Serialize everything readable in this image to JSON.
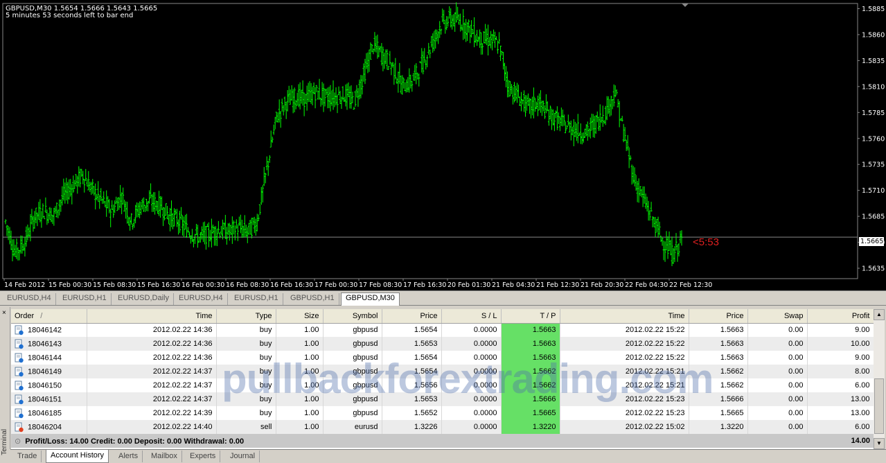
{
  "chart": {
    "title": "GBPUSD,M30  1.5654 1.5666 1.5643 1.5665",
    "subtitle": "5 minutes 53 seconds left to bar end",
    "countdown": "<5:53",
    "current_price": "1.5665",
    "colors": {
      "background": "#000000",
      "candle": "#00ff00",
      "text": "#ffffff",
      "countdown": "#e02020",
      "bid_line": "#888888"
    }
  },
  "chart_data": {
    "type": "line",
    "title": "GBPUSD,M30",
    "xlabel": "",
    "ylabel": "",
    "ylim": [
      1.5625,
      1.589
    ],
    "y_ticks": [
      "1.5885",
      "1.5860",
      "1.5835",
      "1.5810",
      "1.5785",
      "1.5760",
      "1.5735",
      "1.5710",
      "1.5685",
      "1.5660",
      "1.5635"
    ],
    "x_ticks": [
      "14 Feb 2012",
      "15 Feb 00:30",
      "15 Feb 08:30",
      "15 Feb 16:30",
      "16 Feb 00:30",
      "16 Feb 08:30",
      "16 Feb 16:30",
      "17 Feb 00:30",
      "17 Feb 08:30",
      "17 Feb 16:30",
      "20 Feb 01:30",
      "21 Feb 04:30",
      "21 Feb 12:30",
      "21 Feb 20:30",
      "22 Feb 04:30",
      "22 Feb 12:30"
    ],
    "series": [
      {
        "values": [
          1.568,
          1.565,
          1.566,
          1.5685,
          1.569,
          1.5686,
          1.5705,
          1.5715,
          1.5725,
          1.571,
          1.57,
          1.569,
          1.5705,
          1.568,
          1.5695,
          1.57,
          1.5695,
          1.5685,
          1.568,
          1.567,
          1.5665,
          1.5668,
          1.5672,
          1.567,
          1.5674,
          1.567,
          1.568,
          1.573,
          1.578,
          1.5795,
          1.58,
          1.5798,
          1.5805,
          1.58,
          1.58,
          1.5802,
          1.5795,
          1.582,
          1.585,
          1.584,
          1.583,
          1.581,
          1.5815,
          1.583,
          1.585,
          1.587,
          1.5875,
          1.5873,
          1.5865,
          1.5855,
          1.5855,
          1.585,
          1.581,
          1.58,
          1.579,
          1.5795,
          1.5785,
          1.5778,
          1.5772,
          1.5768,
          1.5765,
          1.5775,
          1.5785,
          1.5805,
          1.576,
          1.572,
          1.57,
          1.568,
          1.566,
          1.5648,
          1.5665
        ]
      }
    ]
  },
  "chart_tabs": [
    "EURUSD,H4",
    "EURUSD,H1",
    "EURUSD,Daily",
    "EURUSD,H4",
    "EURUSD,H1",
    "GBPUSD,H1",
    "GBPUSD,M30"
  ],
  "terminal": {
    "side_label": "Terminal",
    "close_glyph": "×",
    "columns": [
      "Order",
      "Time",
      "Type",
      "Size",
      "Symbol",
      "Price",
      "S / L",
      "T / P",
      "Time",
      "Price",
      "Swap",
      "Profit"
    ],
    "sort_indicator": "/",
    "rows": [
      {
        "order": "18046142",
        "open_time": "2012.02.22 14:36",
        "type": "buy",
        "size": "1.00",
        "symbol": "gbpusd",
        "price": "1.5654",
        "sl": "0.0000",
        "tp": "1.5663",
        "close_time": "2012.02.22 15:22",
        "close_price": "1.5663",
        "swap": "0.00",
        "profit": "9.00"
      },
      {
        "order": "18046143",
        "open_time": "2012.02.22 14:36",
        "type": "buy",
        "size": "1.00",
        "symbol": "gbpusd",
        "price": "1.5653",
        "sl": "0.0000",
        "tp": "1.5663",
        "close_time": "2012.02.22 15:22",
        "close_price": "1.5663",
        "swap": "0.00",
        "profit": "10.00"
      },
      {
        "order": "18046144",
        "open_time": "2012.02.22 14:36",
        "type": "buy",
        "size": "1.00",
        "symbol": "gbpusd",
        "price": "1.5654",
        "sl": "0.0000",
        "tp": "1.5663",
        "close_time": "2012.02.22 15:22",
        "close_price": "1.5663",
        "swap": "0.00",
        "profit": "9.00"
      },
      {
        "order": "18046149",
        "open_time": "2012.02.22 14:37",
        "type": "buy",
        "size": "1.00",
        "symbol": "gbpusd",
        "price": "1.5654",
        "sl": "0.0000",
        "tp": "1.5662",
        "close_time": "2012.02.22 15:21",
        "close_price": "1.5662",
        "swap": "0.00",
        "profit": "8.00"
      },
      {
        "order": "18046150",
        "open_time": "2012.02.22 14:37",
        "type": "buy",
        "size": "1.00",
        "symbol": "gbpusd",
        "price": "1.5656",
        "sl": "0.0000",
        "tp": "1.5662",
        "close_time": "2012.02.22 15:21",
        "close_price": "1.5662",
        "swap": "0.00",
        "profit": "6.00"
      },
      {
        "order": "18046151",
        "open_time": "2012.02.22 14:37",
        "type": "buy",
        "size": "1.00",
        "symbol": "gbpusd",
        "price": "1.5653",
        "sl": "0.0000",
        "tp": "1.5666",
        "close_time": "2012.02.22 15:23",
        "close_price": "1.5666",
        "swap": "0.00",
        "profit": "13.00"
      },
      {
        "order": "18046185",
        "open_time": "2012.02.22 14:39",
        "type": "buy",
        "size": "1.00",
        "symbol": "gbpusd",
        "price": "1.5652",
        "sl": "0.0000",
        "tp": "1.5665",
        "close_time": "2012.02.22 15:23",
        "close_price": "1.5665",
        "swap": "0.00",
        "profit": "13.00"
      },
      {
        "order": "18046204",
        "open_time": "2012.02.22 14:40",
        "type": "sell",
        "size": "1.00",
        "symbol": "eurusd",
        "price": "1.3226",
        "sl": "0.0000",
        "tp": "1.3220",
        "close_time": "2012.02.22 15:02",
        "close_price": "1.3220",
        "swap": "0.00",
        "profit": "6.00"
      }
    ],
    "summary": {
      "text": "Profit/Loss: 14.00  Credit: 0.00  Deposit: 0.00  Withdrawal: 0.00",
      "total": "14.00"
    },
    "tabs": [
      "Trade",
      "Account History",
      "Alerts",
      "Mailbox",
      "Experts",
      "Journal"
    ],
    "active_tab": "Account History"
  },
  "watermark": "pullbackforextrading.com"
}
